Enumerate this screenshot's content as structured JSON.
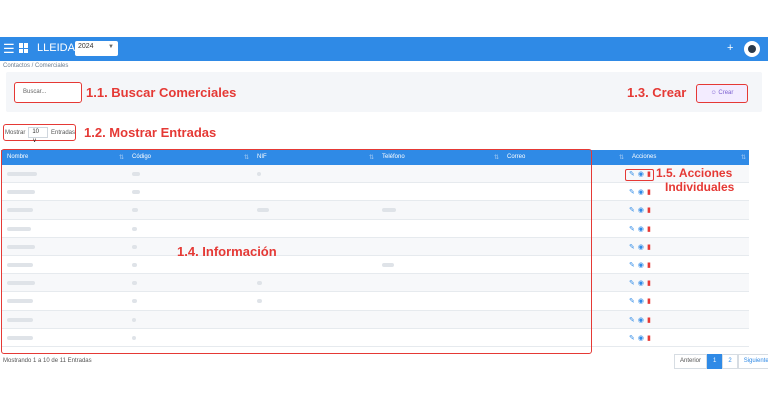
{
  "topbar": {
    "title": "LLEIDA 1",
    "year": "2024",
    "plus": "+"
  },
  "breadcrumb": "Contactos / Comerciales",
  "search": {
    "placeholder": "Buscar..."
  },
  "create_button": "Crear",
  "show": {
    "label_before": "Mostrar",
    "value": "10",
    "label_after": "Entradas"
  },
  "annotations": {
    "search": "1.1. Buscar Comerciales",
    "show": "1.2. Mostrar Entradas",
    "create": "1.3. Crear",
    "info": "1.4. Información",
    "actions_line1": "1.5. Acciones",
    "actions_line2": "Individuales"
  },
  "table": {
    "columns": [
      "Nombre",
      "Código",
      "NIF",
      "Teléfono",
      "Correo",
      "Acciones"
    ],
    "row_count": 10
  },
  "footer": {
    "info": "Mostrando 1 a 10 de 11 Entradas",
    "prev": "Anterior",
    "pages": [
      "1",
      "2"
    ],
    "next": "Siguiente"
  },
  "colors": {
    "primary": "#2f8ae6",
    "annotation": "#e53935"
  },
  "icons": [
    "menu-icon",
    "apps-grid-icon",
    "plus-icon",
    "avatar-icon",
    "edit-icon",
    "view-icon",
    "delete-icon",
    "user-add-icon"
  ]
}
